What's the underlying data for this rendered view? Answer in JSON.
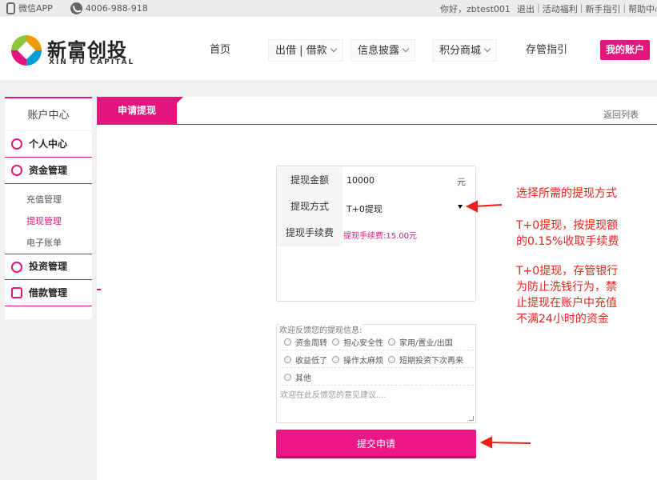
{
  "topbar": {
    "wechat_app": "微信APP",
    "phone": "4006-988-918",
    "greeting": "你好，zbtest001",
    "links": [
      "退出",
      "活动福利",
      "新手指引",
      "帮助中心"
    ]
  },
  "header": {
    "logo_cn": "新富创投",
    "logo_en": "XIN FU CAPITAL",
    "nav": {
      "home": "首页",
      "lend_borrow": "出借 | 借款",
      "disclosure": "信息披露",
      "points_mall": "积分商城",
      "custody_guide": "存管指引"
    },
    "my_account": "我的账户"
  },
  "sidebar": {
    "title": "账户中心",
    "personal_center": "个人中心",
    "fund_management": "资金管理",
    "fund_items": [
      "充值管理",
      "提现管理",
      "电子账单"
    ],
    "investment_management": "投资管理",
    "loan_management": "借款管理"
  },
  "main": {
    "tab": "申请提现",
    "back_link": "返回列表",
    "form": {
      "amount_label": "提现金额",
      "amount_value": "10000",
      "amount_unit": "元",
      "method_label": "提现方式",
      "method_value": "T+0提现",
      "fee_label": "提现手续费",
      "fee_value": "提现手续费:15.00元"
    },
    "feedback": {
      "legend": "欢迎反馈您的提现信息:",
      "options": [
        "资金周转",
        "担心安全性",
        "家用/置业/出国",
        "收益低了",
        "操作太麻烦",
        "短期投资下次再来",
        "其他"
      ],
      "placeholder": "欢迎在此反馈您的意见建议...."
    },
    "submit": "提交申请"
  },
  "annotations": [
    "选择所需的提现方式",
    "T+0提现，按提现额",
    "的0.15%收取手续费",
    "T+0提现，存管银行",
    "为防止洗钱行为，禁",
    "止提现在账户中充值",
    "不满24小时的资金"
  ],
  "colors": {
    "accent": "#e4157c",
    "annotation": "#e8231c"
  }
}
